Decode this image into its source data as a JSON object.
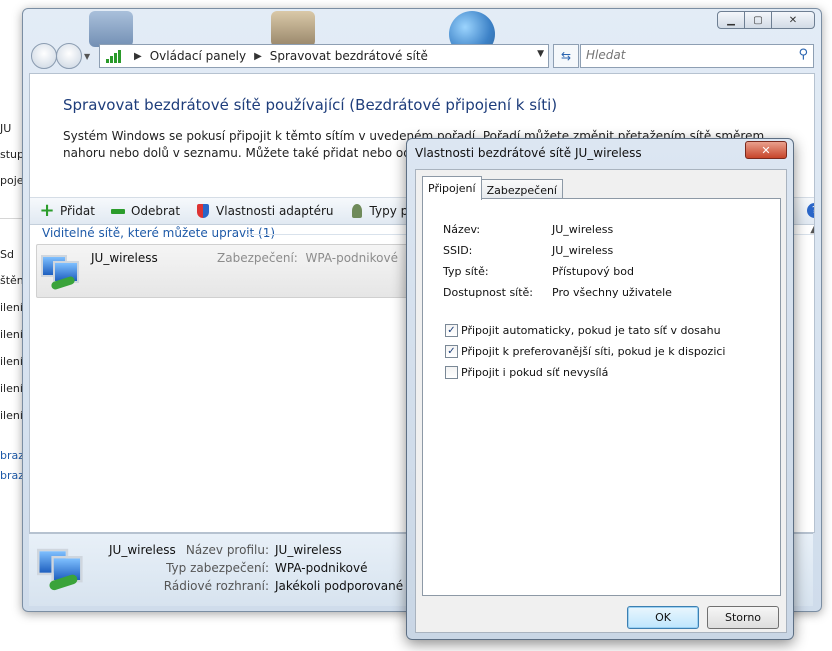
{
  "background_window": {
    "fragments": [
      "JU",
      "stup",
      "pojen",
      "Sd",
      "štěn",
      "ilení",
      "ilení",
      "ilení",
      "ilení",
      "ilení"
    ],
    "links": [
      "braz",
      "braz"
    ]
  },
  "window": {
    "address_bar": {
      "crumbs": [
        "Ovládací panely",
        "Spravovat bezdrátové sítě"
      ]
    },
    "search": {
      "placeholder": "Hledat"
    },
    "page": {
      "heading": "Spravovat bezdrátové sítě používající (Bezdrátové připojení k síti)",
      "intro": "Systém Windows se pokusí připojit k těmto sítím v uvedeném pořadí. Pořadí můžete změnit přetažením sítě směrem nahoru nebo dolů v seznamu. Můžete také přidat nebo odebrat síťové profily."
    },
    "toolbar": {
      "add": "Přidat",
      "remove": "Odebrat",
      "adapter_properties": "Vlastnosti adaptéru",
      "profile_types": "Typy profilů"
    },
    "group_header": "Viditelné sítě, které můžete upravit (1)",
    "networks": [
      {
        "name": "JU_wireless",
        "security_label": "Zabezpečení:",
        "security_value": "WPA-podnikové"
      }
    ],
    "details": {
      "name": "JU_wireless",
      "rows": [
        {
          "label": "Název profilu:",
          "value": "JU_wireless"
        },
        {
          "label": "Typ zabezpečení:",
          "value": "WPA-podnikové"
        },
        {
          "label": "Rádiové rozhraní:",
          "value": "Jakékoli podporované"
        }
      ]
    }
  },
  "dialog": {
    "title": "Vlastnosti bezdrátové sítě JU_wireless",
    "close": "✕",
    "tabs": [
      "Připojení",
      "Zabezpečení"
    ],
    "active_tab": "Připojení",
    "properties": [
      {
        "label": "Název:",
        "value": "JU_wireless"
      },
      {
        "label": "SSID:",
        "value": "JU_wireless"
      },
      {
        "label": "Typ sítě:",
        "value": "Přístupový bod"
      },
      {
        "label": "Dostupnost sítě:",
        "value": "Pro všechny uživatele"
      }
    ],
    "checkboxes": [
      {
        "label": "Připojit automaticky, pokud je tato síť v dosahu",
        "checked": true
      },
      {
        "label": "Připojit k preferovanější síti, pokud je k dispozici",
        "checked": true
      },
      {
        "label": "Připojit i pokud síť nevysílá",
        "checked": false
      }
    ],
    "ok": "OK",
    "cancel": "Storno"
  }
}
